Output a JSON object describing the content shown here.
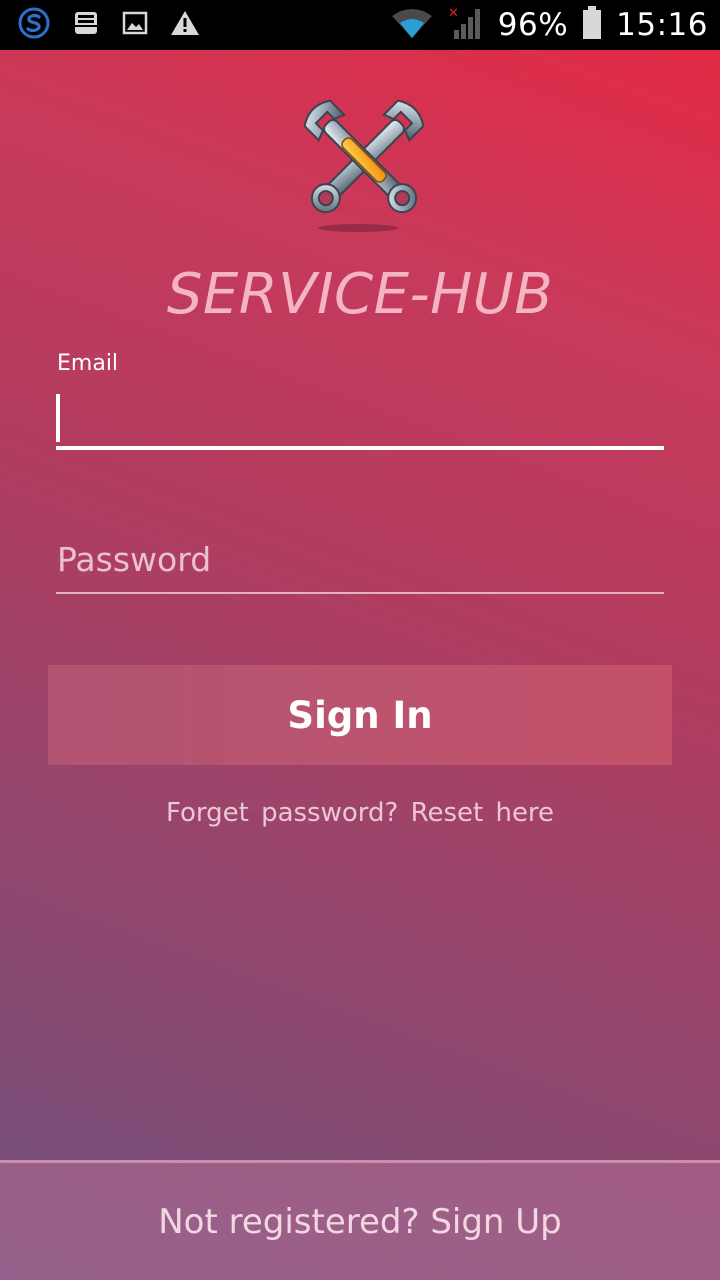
{
  "status_bar": {
    "icons": [
      "sync-icon",
      "inbox-icon",
      "image-icon",
      "warning-icon",
      "wifi-icon",
      "signal-icon",
      "battery-icon"
    ],
    "battery": "96%",
    "time": "15:16"
  },
  "app": {
    "logo": "tools-wrench-icon",
    "title": "SERVICE-HUB"
  },
  "form": {
    "email_label": "Email",
    "email_value": "",
    "password_placeholder": "Password",
    "password_value": "",
    "signin_label": "Sign In",
    "forgot_text": "Forget  password? Reset  here"
  },
  "footer": {
    "signup_text": "Not registered? Sign Up"
  },
  "colors": {
    "gradient_top": "#e32a45",
    "gradient_bottom": "#6f5380",
    "title_color": "#f3b4c4",
    "button_color": "#bb546f"
  }
}
